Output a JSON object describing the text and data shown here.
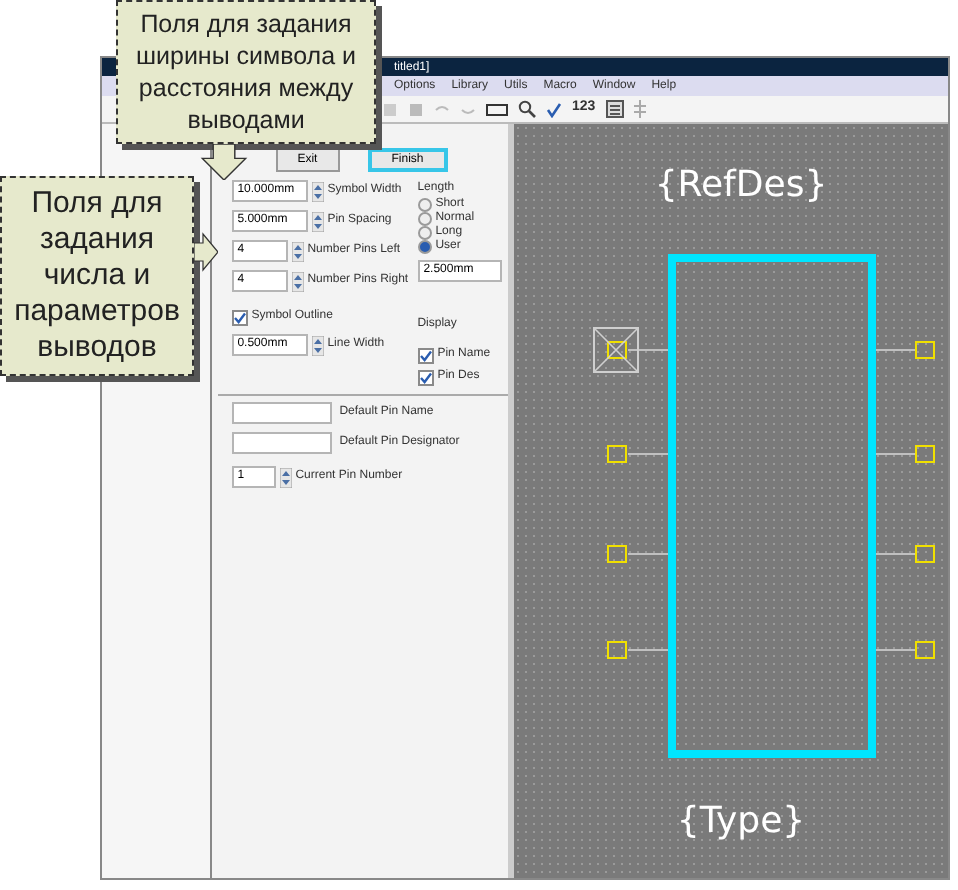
{
  "callouts": [
    {
      "text": "Поля для задания ширины символа и расстояния между выводами"
    },
    {
      "text": "Поля для задания числа и параметров выводов"
    }
  ],
  "window": {
    "title": "titled1]"
  },
  "menu": [
    "Options",
    "Library",
    "Utils",
    "Macro",
    "Window",
    "Help"
  ],
  "toolbar": {
    "counter": "123"
  },
  "buttons": [
    {
      "label": "Exit",
      "focused": false
    },
    {
      "label": "Finish",
      "focused": true
    }
  ],
  "fields": [
    {
      "value": "10.000mm",
      "label": "Symbol Width"
    },
    {
      "value": "5.000mm",
      "label": "Pin Spacing"
    },
    {
      "value": "4",
      "label": "Number Pins Left"
    },
    {
      "value": "4",
      "label": "Number Pins Right"
    }
  ],
  "symbol_outline": {
    "label": "Symbol Outline",
    "checked": true
  },
  "line_width": {
    "value": "0.500mm",
    "label": "Line Width"
  },
  "length": {
    "title": "Length",
    "options": [
      {
        "label": "Short",
        "selected": false
      },
      {
        "label": "Normal",
        "selected": false
      },
      {
        "label": "Long",
        "selected": false
      },
      {
        "label": "User",
        "selected": true
      }
    ],
    "value": "2.500mm"
  },
  "display": {
    "title": "Display",
    "options": [
      {
        "label": "Pin Name",
        "checked": true
      },
      {
        "label": "Pin Des",
        "checked": true
      }
    ]
  },
  "defaults": [
    {
      "label": "Default Pin Name"
    },
    {
      "label": "Default Pin Designator"
    }
  ],
  "current_pin": {
    "value": "1",
    "label": "Current Pin Number"
  },
  "canvas": {
    "refdes": "{RefDes}",
    "type": "{Type}"
  }
}
